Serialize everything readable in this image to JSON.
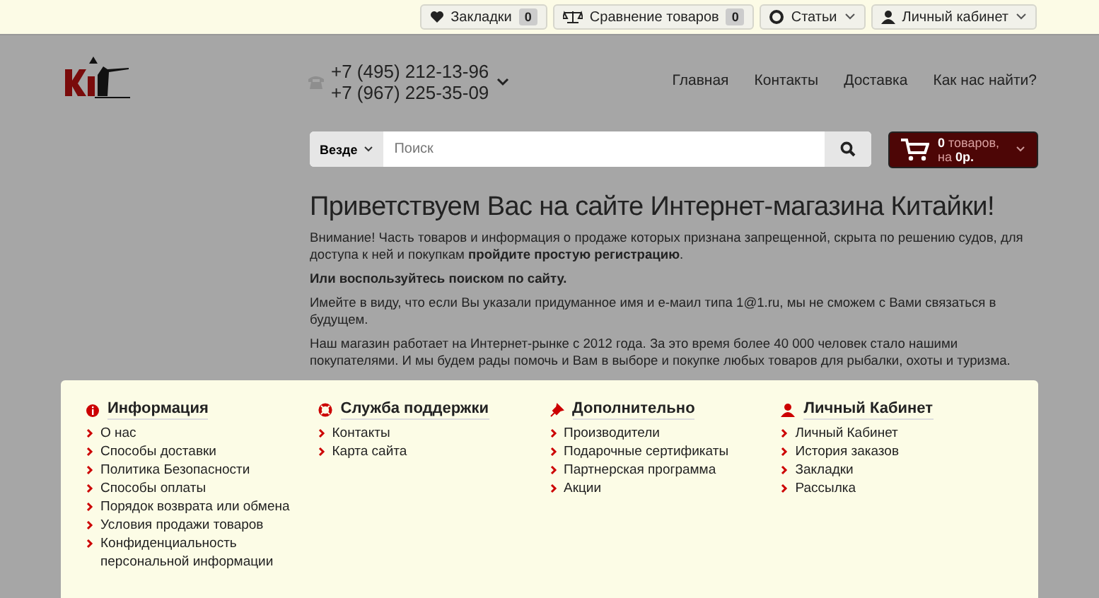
{
  "top_bar": [
    {
      "kind": "counter",
      "label": "Закладки",
      "badge": "0"
    },
    {
      "kind": "counter",
      "label": "Сравнение товаров",
      "badge": "0"
    },
    {
      "kind": "dropdown",
      "label": "Статьи"
    },
    {
      "kind": "dropdown",
      "label": "Личный кабинет"
    }
  ],
  "header": {
    "phones": [
      "+7 (495) 212-13-96",
      "+7 (967) 225-35-09"
    ],
    "nav": [
      "Главная",
      "Контакты",
      "Доставка",
      "Как нас найти?"
    ]
  },
  "search": {
    "scope": "Везде",
    "placeholder": "Поиск"
  },
  "cart": {
    "count": "0",
    "count_label": "товаров,",
    "total_prefix": "на",
    "total": "0р."
  },
  "welcome": {
    "title": "Приветствуем Вас на сайте Интернет-магазина Китайки!",
    "paragraphs": [
      "Внимание! Часть товаров и информация о продаже которых признана запрещенной, скрыта по решению судов, для доступа к ней и покупкам **пройдите простую регистрацию**.",
      "**Или воспользуйтесь поиском по сайту.**",
      "Имейте в виду, что если Вы указали придуманное имя и е-маил типа 1@1.ru, мы не сможем с Вами связаться в будущем.",
      "Наш магазин работает на Интернет-рынке с 2012 года. За это время более 40 000 человек стало нашими покупателями. И мы будем рады помочь и Вам в выборе и покупке любых товаров для рыбалки, охоты и туризма."
    ]
  },
  "footer": [
    {
      "kind": "info",
      "title": "Информация",
      "links": [
        "О нас",
        "Способы доставки",
        "Политика Безопасности",
        "Способы оплаты",
        "Порядок возврата или обмена",
        "Условия продажи товаров",
        "Конфиденциальность персональной информации"
      ]
    },
    {
      "kind": "support",
      "title": "Служба поддержки",
      "links": [
        "Контакты",
        "Карта сайта"
      ]
    },
    {
      "kind": "extra",
      "title": "Дополнительно",
      "links": [
        "Производители",
        "Подарочные сертификаты",
        "Партнерская программа",
        "Акции"
      ]
    },
    {
      "kind": "account",
      "title": "Личный Кабинет",
      "links": [
        "Личный Кабинет",
        "История заказов",
        "Закладки",
        "Рассылка"
      ]
    }
  ]
}
